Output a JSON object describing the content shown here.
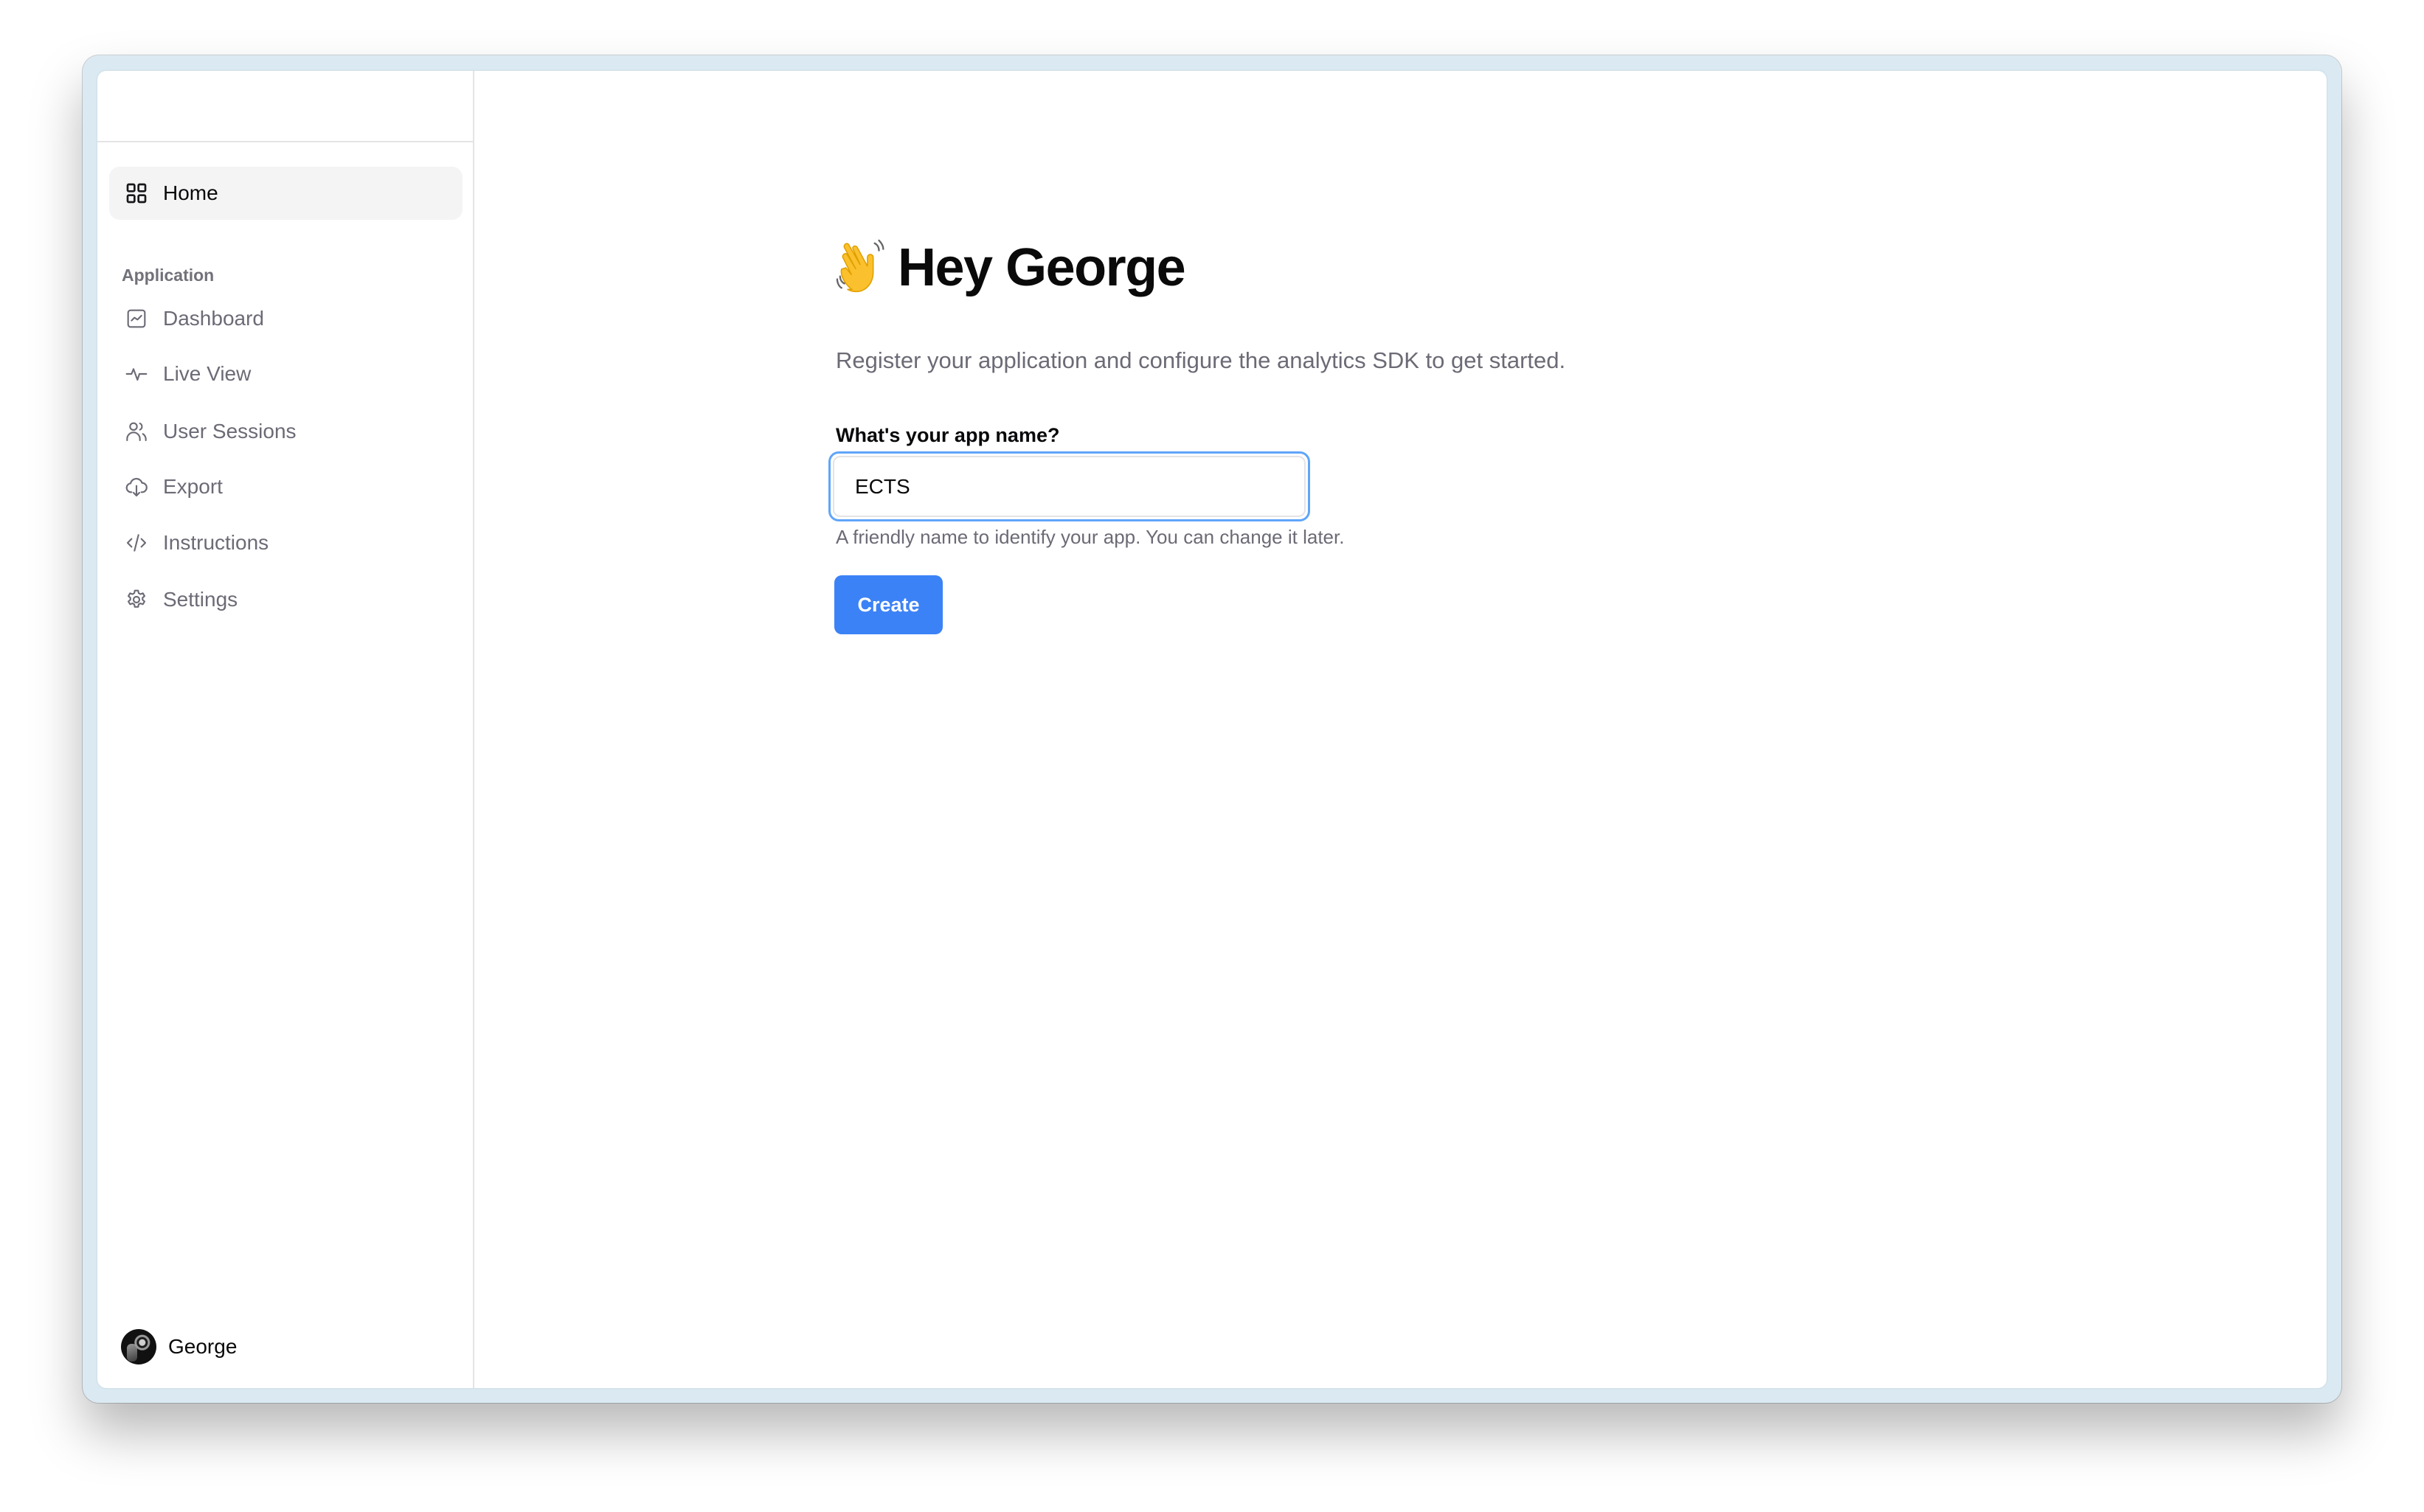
{
  "sidebar": {
    "home": {
      "label": "Home",
      "icon": "grid-icon",
      "active": true
    },
    "section_label": "Application",
    "items": [
      {
        "label": "Dashboard",
        "icon": "chart-icon"
      },
      {
        "label": "Live View",
        "icon": "activity-icon"
      },
      {
        "label": "User Sessions",
        "icon": "users-icon"
      },
      {
        "label": "Export",
        "icon": "cloud-download-icon"
      },
      {
        "label": "Instructions",
        "icon": "code-icon"
      },
      {
        "label": "Settings",
        "icon": "gear-icon"
      }
    ],
    "user": {
      "name": "George",
      "avatar": "avatar-image"
    }
  },
  "main": {
    "greeting_emoji": "👋",
    "title": "Hey George",
    "subtitle": "Register your application and configure the analytics SDK to get started.",
    "form": {
      "label": "What's your app name?",
      "input_value": "ECTS",
      "helper": "A friendly name to identify your app. You can change it later.",
      "submit_label": "Create"
    }
  },
  "colors": {
    "accent": "#3b82f6",
    "focus_ring": "#60a5fa",
    "frame": "#dbeaf2",
    "muted_text": "#6b6b76",
    "active_item_bg": "#f4f4f5"
  }
}
